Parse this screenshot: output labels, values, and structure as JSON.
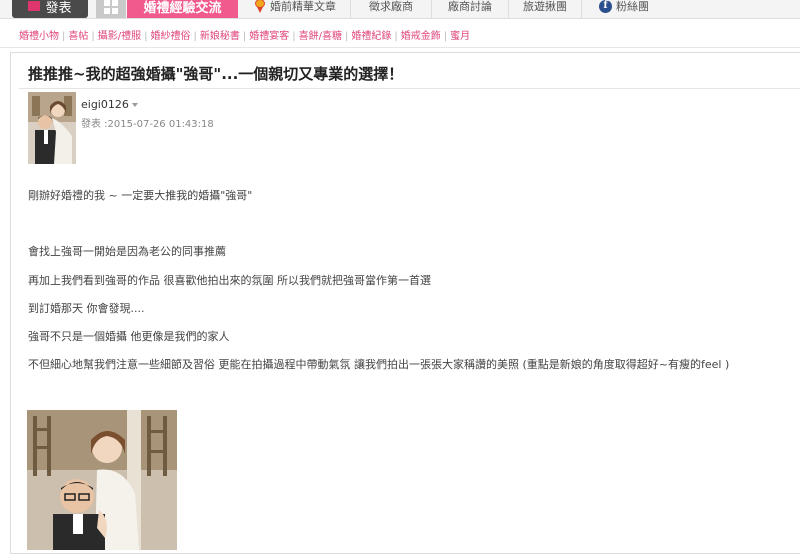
{
  "nav": {
    "post_button": "發表",
    "active_tab": "婚禮經驗交流",
    "items": [
      {
        "label": "婚前精華文章",
        "icon": "award-ribbon-icon"
      },
      {
        "label": "徵求廠商",
        "icon": ""
      },
      {
        "label": "廠商討論",
        "icon": ""
      },
      {
        "label": "旅遊揪團",
        "icon": ""
      },
      {
        "label": "粉絲團",
        "icon": "facebook-icon"
      }
    ]
  },
  "categories": [
    "婚禮小物",
    "喜帖",
    "攝影/禮服",
    "婚紗禮俗",
    "新娘秘書",
    "婚禮宴客",
    "喜餅/喜糖",
    "婚禮紀錄",
    "婚戒金飾",
    "蜜月"
  ],
  "post": {
    "title": "推推推~我的超強婚攝\"強哥\"...一個親切又專業的選擇！",
    "author": "eigi0126",
    "posted": "發表 :2015-07-26 01:43:18",
    "paragraphs": [
      "剛辦好婚禮的我 ~ 一定要大推我的婚攝\"強哥\"",
      "會找上強哥一開始是因為老公的同事推薦",
      "再加上我們看到強哥的作品 很喜歡他拍出來的氛圍  所以我們就把強哥當作第一首選",
      "到訂婚那天  你會發現....",
      "強哥不只是一個婚攝  他更像是我們的家人",
      "不但細心地幫我們注意一些細節及習俗 更能在拍攝過程中帶動氣氛 讓我們拍出一張張大家稱讚的美照 (重點是新娘的角度取得超好~有瘦的feel )"
    ]
  },
  "colors": {
    "accent": "#f05a8d",
    "category_text": "#e0467c"
  }
}
